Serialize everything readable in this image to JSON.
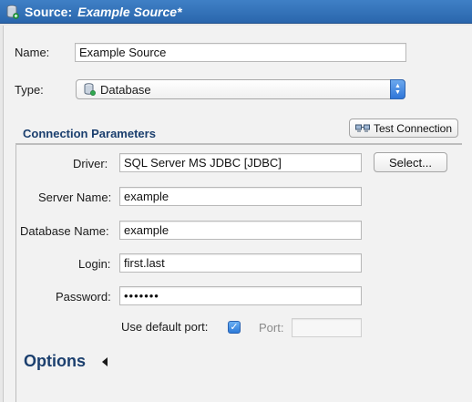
{
  "window": {
    "title_prefix": "Source:",
    "title_name": "Example Source*",
    "icon": "database-source-icon"
  },
  "form": {
    "name_label": "Name:",
    "name_value": "Example Source",
    "type_label": "Type:",
    "type_value": "Database",
    "type_icon": "database-icon"
  },
  "connection": {
    "section_title": "Connection Parameters",
    "test_button": "Test Connection",
    "test_icon": "test-connection-icon",
    "driver_label": "Driver:",
    "driver_value": "SQL Server MS JDBC [JDBC]",
    "select_button": "Select...",
    "server_label": "Server Name:",
    "server_value": "example",
    "database_label": "Database Name:",
    "database_value": "example",
    "login_label": "Login:",
    "login_value": "first.last",
    "password_label": "Password:",
    "password_value": "•••••••",
    "default_port_label": "Use default port:",
    "default_port_checked": true,
    "port_label": "Port:",
    "port_value": ""
  },
  "options": {
    "title": "Options",
    "expanded": false
  },
  "colors": {
    "titlebar": "#2a66ad",
    "section_title": "#1b3f6e",
    "accent": "#2c7ad9"
  }
}
